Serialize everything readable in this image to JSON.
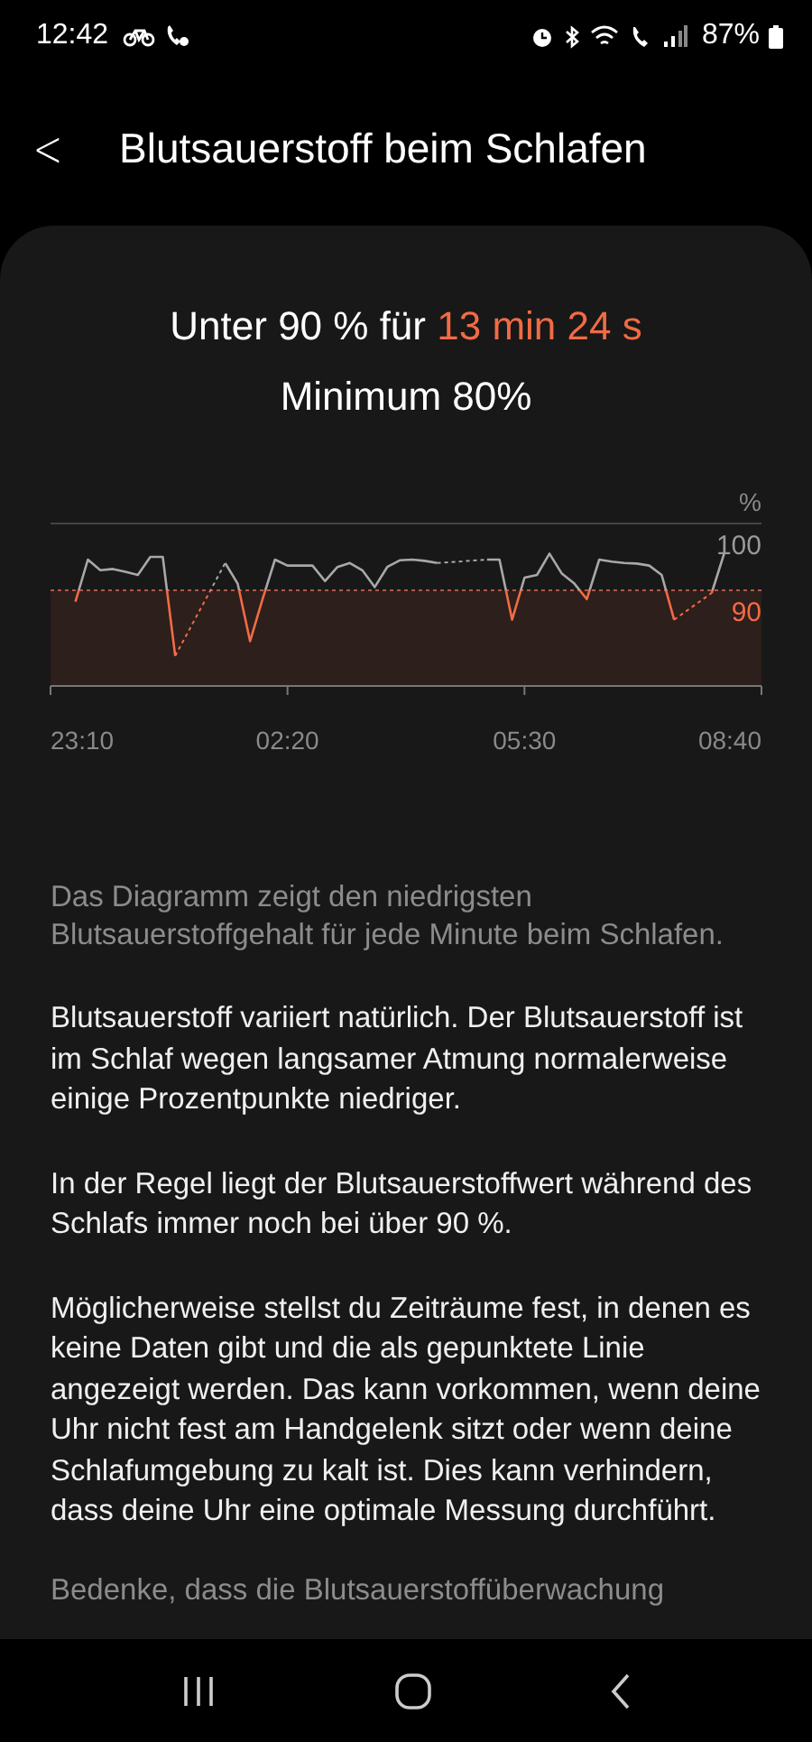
{
  "status_bar": {
    "time": "12:42",
    "battery": "87%"
  },
  "header": {
    "back": "<",
    "title": "Blutsauerstoff beim Schlafen"
  },
  "summary": {
    "prefix": "Unter 90 % für",
    "highlight": "13 min 24 s",
    "minimum": "Minimum 80%"
  },
  "chart": {
    "unit": "%",
    "y_labels": [
      "100",
      "90"
    ],
    "x_labels": [
      "23:10",
      "02:20",
      "05:30",
      "08:40"
    ]
  },
  "caption": "Das Diagramm zeigt den niedrigsten Blutsauerstoffgehalt für jede Minute beim Schlafen.",
  "paragraphs": [
    "Blutsauerstoff variiert natürlich. Der Blutsauerstoff ist im Schlaf wegen langsamer Atmung normalerweise einige Prozentpunkte niedriger.",
    "In der Regel liegt der Blutsauerstoffwert während des Schlafs immer noch bei über 90 %.",
    "Möglicherweise stellst du Zeiträume fest, in denen es keine Daten gibt und die als gepunktete Linie angezeigt werden. Das kann vorkommen, wenn deine Uhr nicht fest am Handgelenk sitzt oder wenn deine Schlafumgebung zu kalt ist. Dies kann verhindern, dass deine Uhr eine optimale Messung durchführt."
  ],
  "footnote": "Bedenke, dass die Blutsauerstoffüberwachung"
}
